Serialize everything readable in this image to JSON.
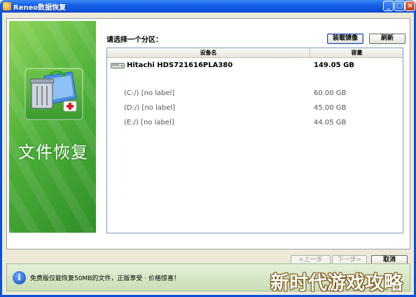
{
  "window": {
    "title": "Reneo数据恢复",
    "minimize": "_",
    "maximize": "□",
    "close": "×"
  },
  "banner": {
    "title": "文件恢复",
    "icon": "recycle-bin-folder-icon"
  },
  "partition": {
    "prompt": "请选择一个分区：",
    "load_image_button": "装载镜像",
    "refresh_button": "刷新",
    "columns": {
      "name": "设备名",
      "size": "容量"
    },
    "disk": {
      "name": "Hitachi HDS721616PLA380",
      "size": "149.05 GB"
    },
    "partitions": [
      {
        "name": "(C:/) [no label]",
        "size": "60.00 GB"
      },
      {
        "name": "(D:/) [no label]",
        "size": "45.00 GB"
      },
      {
        "name": "(E:/) [no label]",
        "size": "44.05 GB"
      }
    ]
  },
  "nav": {
    "prev": "<上一步",
    "next": "下一步>",
    "cancel": "取消"
  },
  "info": {
    "icon": "info-icon",
    "text": "免费版仅能恢复50MB的文件，正版享受 · 价格惊喜！"
  },
  "watermark": {
    "text": "新时代游戏攻略"
  },
  "colors": {
    "title_bar": "#0b4ad1",
    "banner_green": "#4fb13a",
    "info_bar": "#c9dfb6"
  }
}
